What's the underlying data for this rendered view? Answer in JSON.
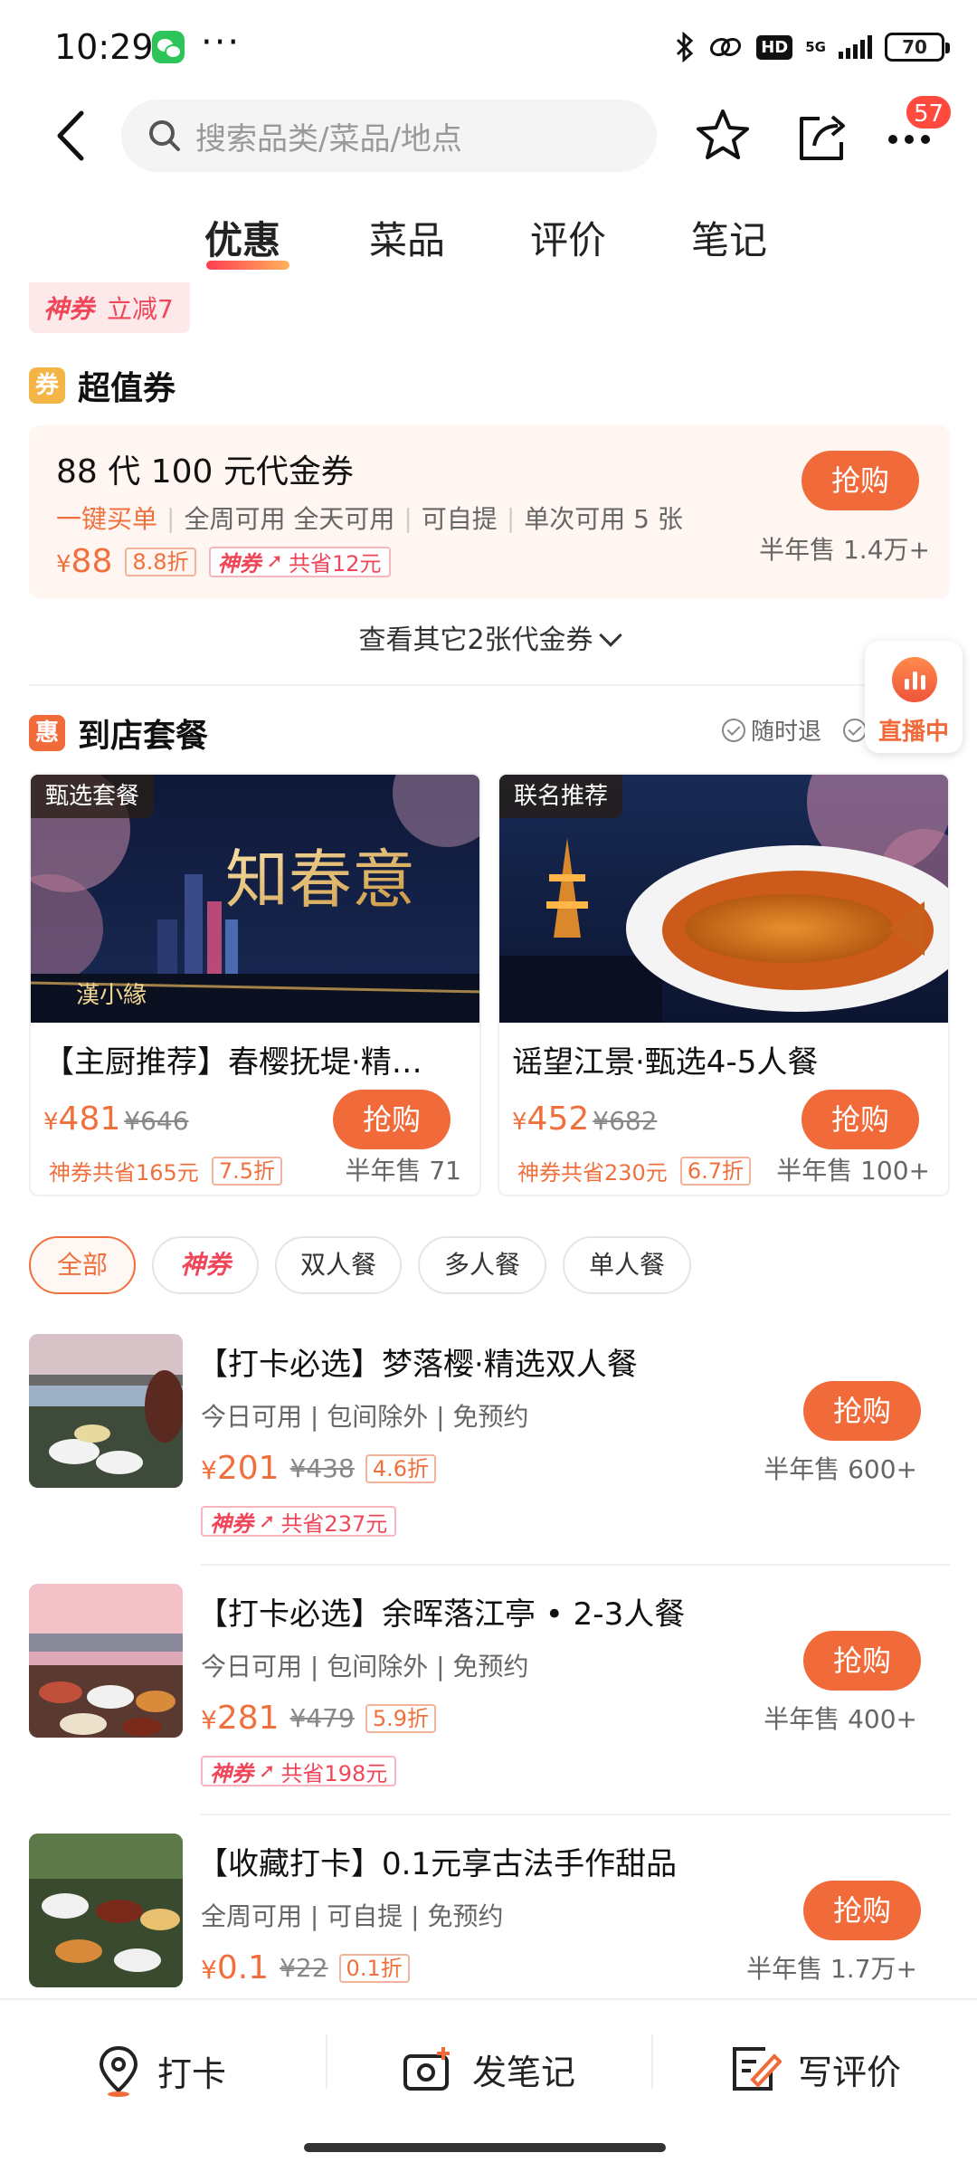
{
  "status_bar": {
    "time": "10:29",
    "dots": "···",
    "net": "5G",
    "hd": "HD",
    "battery": "70"
  },
  "search": {
    "placeholder": "搜索品类/菜品/地点"
  },
  "header": {
    "more_badge": "57"
  },
  "tabs": [
    {
      "label": "优惠",
      "active": true
    },
    {
      "label": "菜品"
    },
    {
      "label": "评价"
    },
    {
      "label": "笔记"
    }
  ],
  "shenquan_strip": {
    "logo": "神券",
    "text": "立减7"
  },
  "voucher_section": {
    "icon": "券",
    "title": "超值券",
    "card": {
      "title": "88 代 100 元代金券",
      "highlight": "一键买单",
      "features": [
        "全周可用 全天可用",
        "可自提",
        "单次可用 5 张"
      ],
      "price_symbol": "¥",
      "price": "88",
      "discount": "8.8折",
      "shen_logo": "神券",
      "shen_save": "共省12元",
      "buy": "抢购",
      "sold": "半年售 1.4万+"
    },
    "more": "查看其它2张代金券"
  },
  "package_section": {
    "icon": "惠",
    "title": "到店套餐",
    "tag1": "随时退",
    "live_label": "直播中",
    "cards": [
      {
        "label": "甄选套餐",
        "img_title": "知春意",
        "img_logo": "漢小緣",
        "title": "【主厨推荐】春樱抚堤·精…",
        "price_symbol": "¥",
        "price": "481",
        "old_price": "¥646",
        "save": "神券共省165元",
        "discount": "7.5折",
        "buy": "抢购",
        "sold": "半年售 71"
      },
      {
        "label": "联名推荐",
        "title": "谣望江景·甄选4-5人餐",
        "price_symbol": "¥",
        "price": "452",
        "old_price": "¥682",
        "save": "神券共省230元",
        "discount": "6.7折",
        "buy": "抢购",
        "sold": "半年售 100+"
      }
    ]
  },
  "filters": [
    "全部",
    "神券",
    "双人餐",
    "多人餐",
    "单人餐"
  ],
  "list": [
    {
      "title": "【打卡必选】梦落樱·精选双人餐",
      "meta": "今日可用 | 包间除外 | 免预约",
      "price_symbol": "¥",
      "price": "201",
      "old_price": "¥438",
      "discount": "4.6折",
      "shen_logo": "神券",
      "shen_save": "共省237元",
      "buy": "抢购",
      "sold": "半年售 600+"
    },
    {
      "title": "【打卡必选】余晖落江亭 • 2-3人餐",
      "meta": "今日可用 | 包间除外 | 免预约",
      "price_symbol": "¥",
      "price": "281",
      "old_price": "¥479",
      "discount": "5.9折",
      "shen_logo": "神券",
      "shen_save": "共省198元",
      "buy": "抢购",
      "sold": "半年售 400+"
    },
    {
      "title": "【收藏打卡】0.1元享古法手作甜品",
      "meta": "全周可用 | 可自提 | 免预约",
      "price_symbol": "¥",
      "price": "0.1",
      "old_price": "¥22",
      "discount": "0.1折",
      "buy": "抢购",
      "sold": "半年售 1.7万+"
    }
  ],
  "bottom_bar": [
    {
      "label": "打卡",
      "icon": "location-pin-icon"
    },
    {
      "label": "发笔记",
      "icon": "camera-plus-icon"
    },
    {
      "label": "写评价",
      "icon": "edit-review-icon"
    }
  ],
  "colors": {
    "accent": "#f06a3a",
    "price": "#f0703d",
    "shen": "#f0465a",
    "badge": "#ff4a3d"
  }
}
